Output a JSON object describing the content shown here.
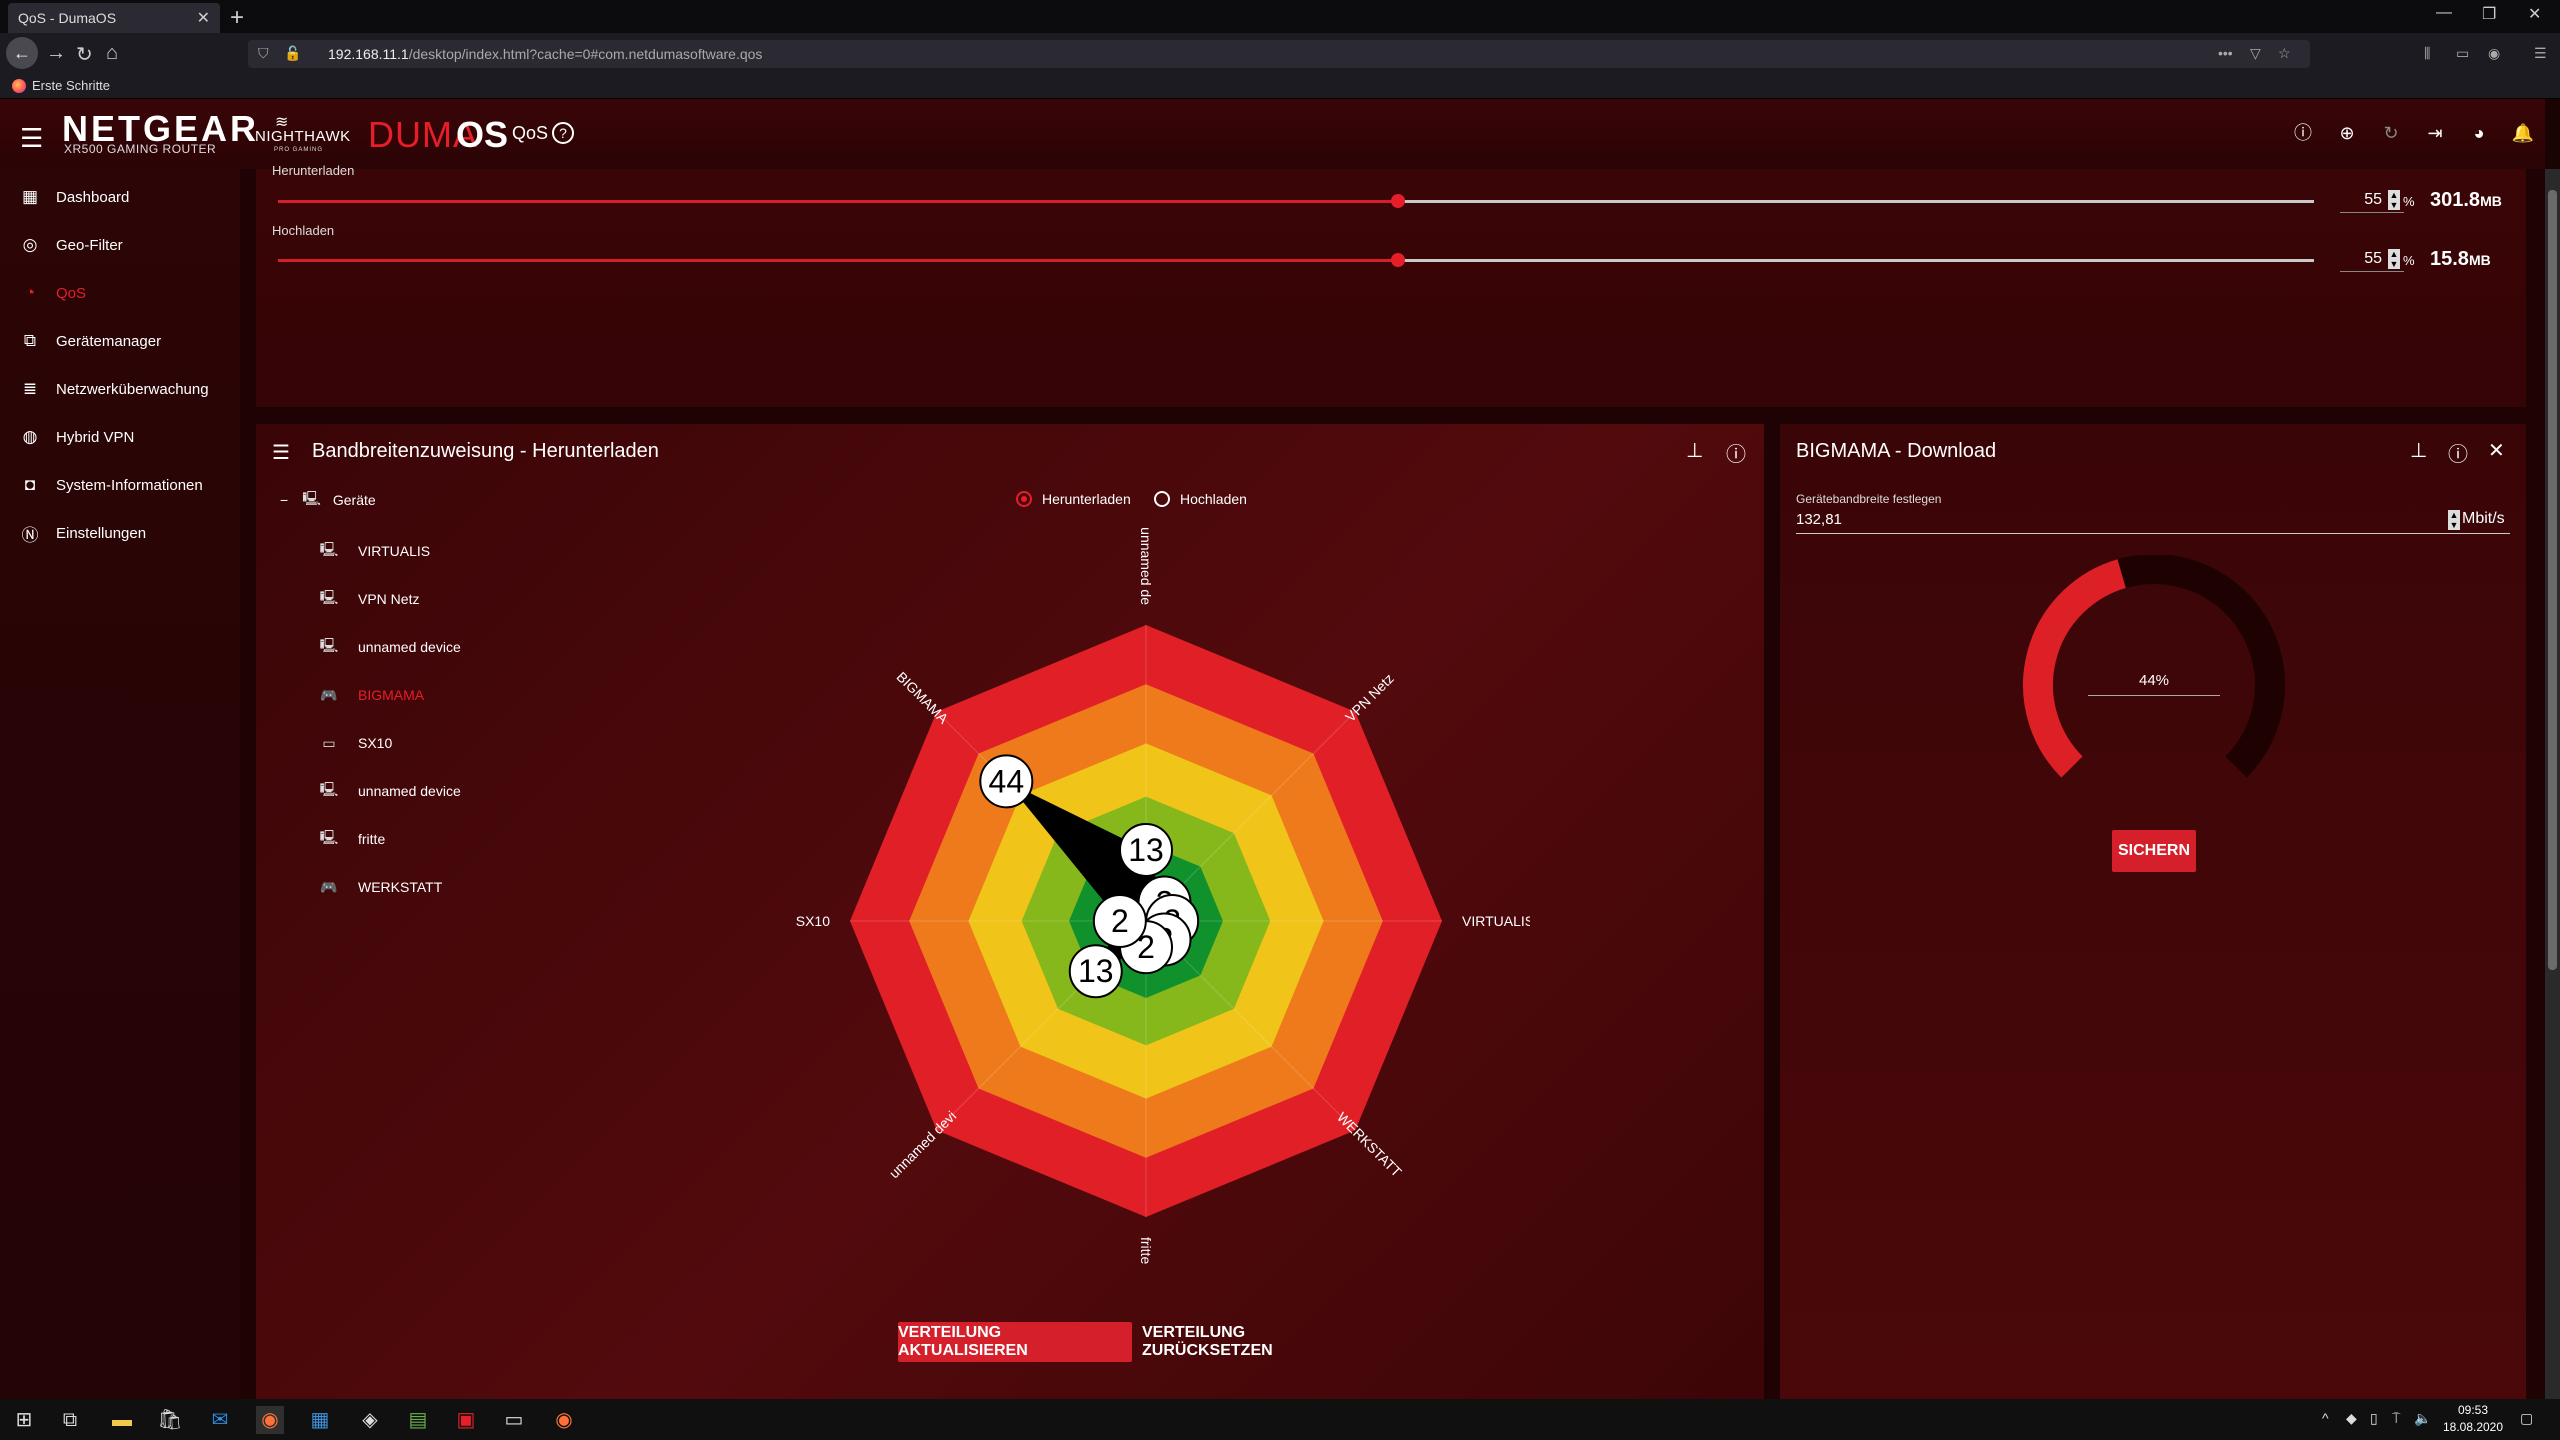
{
  "browser": {
    "tab_title": "QoS - DumaOS",
    "url_host": "192.168.11.1",
    "url_path": "/desktop/index.html?cache=0#com.netdumasoftware.qos",
    "bookmark": "Erste Schritte"
  },
  "header": {
    "brand": "NETGEAR",
    "model": "XR500 GAMING ROUTER",
    "nighthawk": "NIGHTHAWK",
    "progaming": "PRO GAMING",
    "duma": "DUMA",
    "os": "OS",
    "section": "QoS",
    "help": "?",
    "icons": [
      "info-icon",
      "globe-icon",
      "refresh-icon",
      "logout-icon",
      "palette-icon",
      "bell-icon"
    ]
  },
  "sidebar": {
    "items": [
      {
        "label": "Dashboard",
        "icon": "dashboard-icon"
      },
      {
        "label": "Geo-Filter",
        "icon": "geo-filter-icon"
      },
      {
        "label": "QoS",
        "icon": "qos-icon",
        "active": true
      },
      {
        "label": "Gerätemanager",
        "icon": "device-manager-icon"
      },
      {
        "label": "Netzwerküberwachung",
        "icon": "network-monitor-icon"
      },
      {
        "label": "Hybrid VPN",
        "icon": "vpn-icon"
      },
      {
        "label": "System-Informationen",
        "icon": "system-info-icon"
      },
      {
        "label": "Einstellungen",
        "icon": "settings-icon"
      }
    ]
  },
  "bandwidth": {
    "download": {
      "label": "Herunterladen",
      "value": "55",
      "percent": 55,
      "unit": "%",
      "amount": "301.8",
      "amount_unit": "MB"
    },
    "upload": {
      "label": "Hochladen",
      "value": "55",
      "percent": 55,
      "unit": "%",
      "amount": "15.8",
      "amount_unit": "MB"
    }
  },
  "allocation": {
    "title": "Bandbreitenzuweisung - Herunterladen",
    "tree_root": "Geräte",
    "devices": [
      {
        "label": "VIRTUALIS",
        "icon": "computer-icon"
      },
      {
        "label": "VPN Netz",
        "icon": "computer-icon"
      },
      {
        "label": "unnamed device",
        "icon": "computer-icon"
      },
      {
        "label": "BIGMAMA",
        "icon": "gamepad-icon",
        "active": true
      },
      {
        "label": "SX10",
        "icon": "console-icon"
      },
      {
        "label": "unnamed device",
        "icon": "computer-icon"
      },
      {
        "label": "fritte",
        "icon": "computer-icon"
      },
      {
        "label": "WERKSTATT",
        "icon": "gamepad-icon"
      }
    ],
    "radio_download": "Herunterladen",
    "radio_upload": "Hochladen",
    "btn_update": "VERTEILUNG AKTUALISIEREN",
    "btn_reset": "VERTEILUNG ZURÜCKSETZEN",
    "ring_colors": [
      "#e01f26",
      "#ee7a1c",
      "#f0c419",
      "#86b81c",
      "#11912c"
    ]
  },
  "chart_data": {
    "type": "radar",
    "axes": [
      "unnamed de",
      "VPN Netz",
      "VIRTUALIS",
      "WERKSTATT",
      "fritte",
      "unnamed devi",
      "SX10",
      "BIGMAMA"
    ],
    "values": [
      13,
      2,
      2,
      2,
      2,
      13,
      2,
      44
    ]
  },
  "side_panel": {
    "title": "BIGMAMA - Download",
    "field_label": "Gerätebandbreite festlegen",
    "field_value": "132,81",
    "field_unit": "Mbit/s",
    "gauge_percent": 44,
    "gauge_label": "44%",
    "save_button": "SICHERN"
  },
  "taskbar": {
    "time": "09:53",
    "date": "18.08.2020"
  }
}
